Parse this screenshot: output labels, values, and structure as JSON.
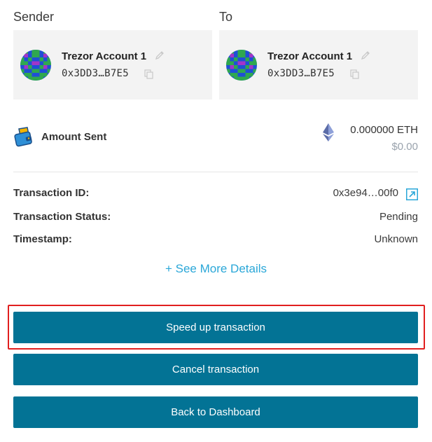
{
  "sender": {
    "label": "Sender",
    "account_name": "Trezor Account 1",
    "address": "0x3DD3…B7E5"
  },
  "recipient": {
    "label": "To",
    "account_name": "Trezor Account 1",
    "address": "0x3DD3…B7E5"
  },
  "amount": {
    "label": "Amount Sent",
    "eth_value": "0.000000 ETH",
    "usd_value": "$0.00"
  },
  "details": {
    "transaction_id_label": "Transaction ID:",
    "transaction_id": "0x3e94…00f0",
    "status_label": "Transaction Status:",
    "status": "Pending",
    "timestamp_label": "Timestamp:",
    "timestamp": "Unknown",
    "see_more": "+ See More Details"
  },
  "actions": {
    "speed_up": "Speed up transaction",
    "cancel": "Cancel transaction",
    "back": "Back to Dashboard"
  },
  "colors": {
    "primary_button": "#037395",
    "link": "#2aa7d8",
    "highlight": "#e11f1f",
    "card_bg": "#f3f3f3"
  }
}
